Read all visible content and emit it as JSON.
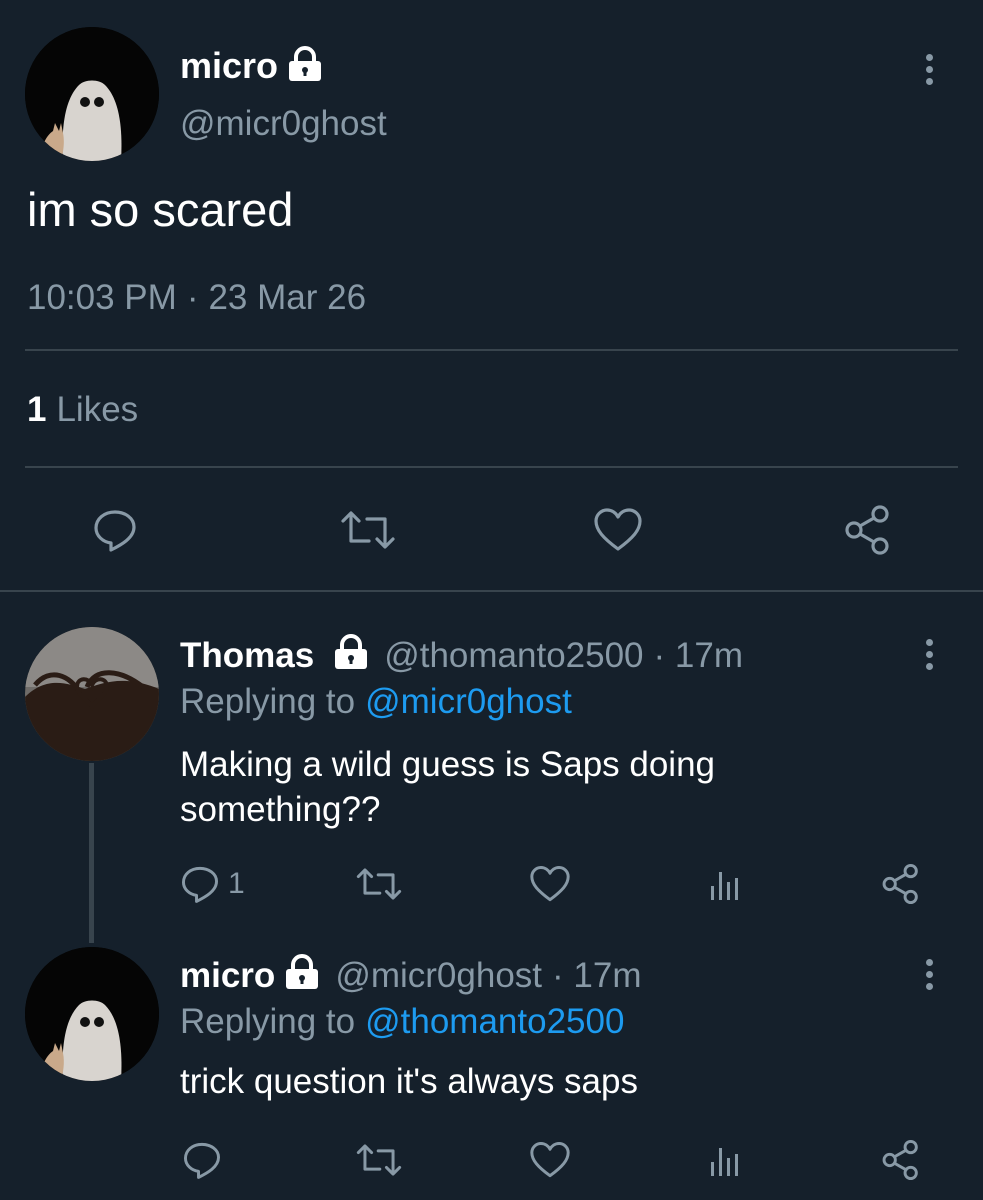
{
  "main_tweet": {
    "display_name": "micro",
    "handle": "@micr0ghost",
    "text": "im so scared",
    "time": "10:03 PM",
    "separator": "·",
    "date": "23 Mar 26",
    "likes_count": "1",
    "likes_label": "Likes"
  },
  "replies": [
    {
      "display_name": "Thomas",
      "handle": "@thomanto2500",
      "age": "· 17m",
      "replying_prefix": "Replying to",
      "replying_to": "@micr0ghost",
      "text_line1": "Making a wild guess is Saps doing",
      "text_line2": "something??",
      "reply_count": "1"
    },
    {
      "display_name": "micro",
      "handle": "@micr0ghost",
      "age": "· 17m",
      "replying_prefix": "Replying to",
      "replying_to": "@thomanto2500",
      "text": "trick question it's always saps"
    }
  ],
  "colors": {
    "background": "#15202b",
    "muted": "#8899a6",
    "link": "#1d9bf0",
    "divider": "#38444d"
  },
  "icons": [
    "lock-icon",
    "more-icon",
    "reply-icon",
    "retweet-icon",
    "like-icon",
    "share-icon",
    "analytics-icon"
  ]
}
